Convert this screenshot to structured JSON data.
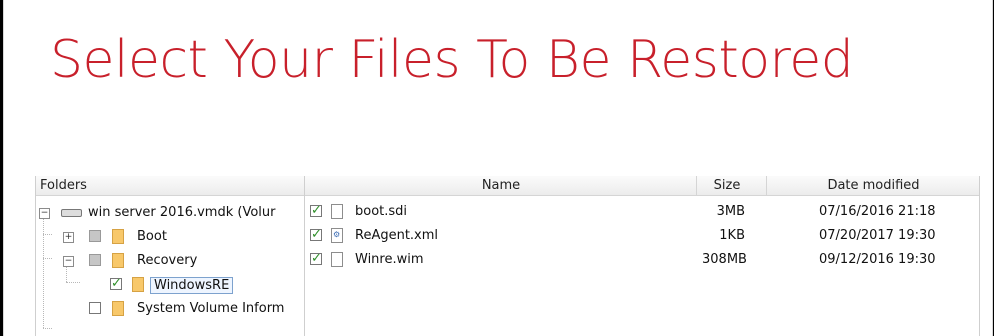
{
  "window": {
    "title": "Select Your Files To Be Restored"
  },
  "browser": {
    "folders_header": "Folders",
    "tree": [
      {
        "label": "win server 2016.vmdk (Volur",
        "state": "expanded",
        "checked": "checked",
        "icon": "disk-icon"
      },
      {
        "label": "Boot",
        "state": "collapsed",
        "checked": "partial",
        "icon": "folder-icon"
      },
      {
        "label": "Recovery",
        "state": "expanded",
        "checked": "partial",
        "icon": "folder-icon"
      },
      {
        "label": "WindowsRE",
        "state": "leaf",
        "checked": "checked",
        "icon": "folder-icon",
        "selected": true
      },
      {
        "label": "System Volume Inform",
        "state": "leaf",
        "checked": "unchecked",
        "icon": "folder-icon"
      }
    ],
    "columns": [
      "Name",
      "Size",
      "Date modified"
    ],
    "files": [
      {
        "name": "boot.sdi",
        "size": "3MB",
        "date": "07/16/2016 21:18",
        "checked": "checked",
        "icon": "file-icon"
      },
      {
        "name": "ReAgent.xml",
        "size": "1KB",
        "date": "07/20/2017 19:30",
        "checked": "checked",
        "icon": "xml-file-icon"
      },
      {
        "name": "Winre.wim",
        "size": "308MB",
        "date": "09/12/2016 19:30",
        "checked": "checked",
        "icon": "file-icon"
      }
    ]
  },
  "colors": {
    "title": "#c8202b",
    "border": "#cfcfcf",
    "check": "#2f8f2a"
  }
}
